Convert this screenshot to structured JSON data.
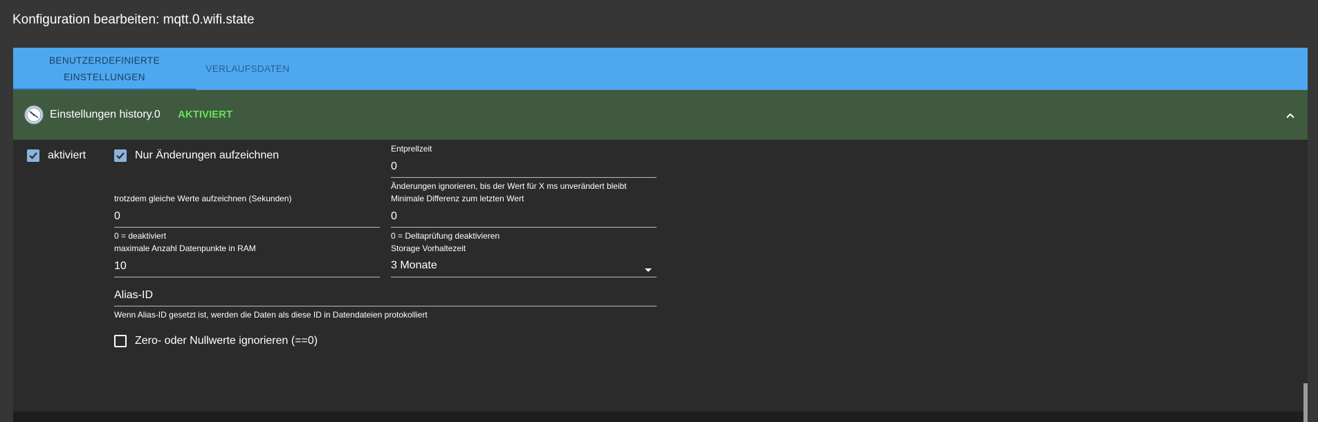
{
  "dialog": {
    "title": "Konfiguration bearbeiten: mqtt.0.wifi.state"
  },
  "tabs": [
    {
      "label": "BENUTZERDEFINIERTE EINSTELLUNGEN",
      "active": true
    },
    {
      "label": "VERLAUFSDATEN",
      "active": false
    }
  ],
  "section": {
    "title": "Einstellungen history.0",
    "status": "AKTIVIERT",
    "status_color": "#67e05a",
    "icon": "clock-icon",
    "toggle_icon": "chevron-up-icon"
  },
  "form": {
    "enabled": {
      "label": "aktiviert",
      "checked": true
    },
    "changes_only": {
      "label": "Nur Änderungen aufzeichnen",
      "checked": true
    },
    "debounce": {
      "label": "Entprellzeit",
      "value": "0",
      "helper": "Änderungen ignorieren, bis der Wert für X ms unverändert bleibt"
    },
    "still_record": {
      "label": "trotzdem gleiche Werte aufzeichnen (Sekunden)",
      "value": "0",
      "helper": "0 = deaktiviert"
    },
    "min_diff": {
      "label": "Minimale Differenz zum letzten Wert",
      "value": "0",
      "helper": "0 = Deltaprüfung deaktivieren"
    },
    "max_ram": {
      "label": "maximale Anzahl Datenpunkte in RAM",
      "value": "10"
    },
    "retention": {
      "label": "Storage Vorhaltezeit",
      "value": "3 Monate"
    },
    "alias": {
      "placeholder": "Alias-ID",
      "value": "",
      "helper": "Wenn Alias-ID gesetzt ist, werden die Daten als diese ID in Datendateien protokolliert"
    },
    "ignore_zero": {
      "label": "Zero- oder Nullwerte ignorieren (==0)",
      "checked": false
    }
  }
}
